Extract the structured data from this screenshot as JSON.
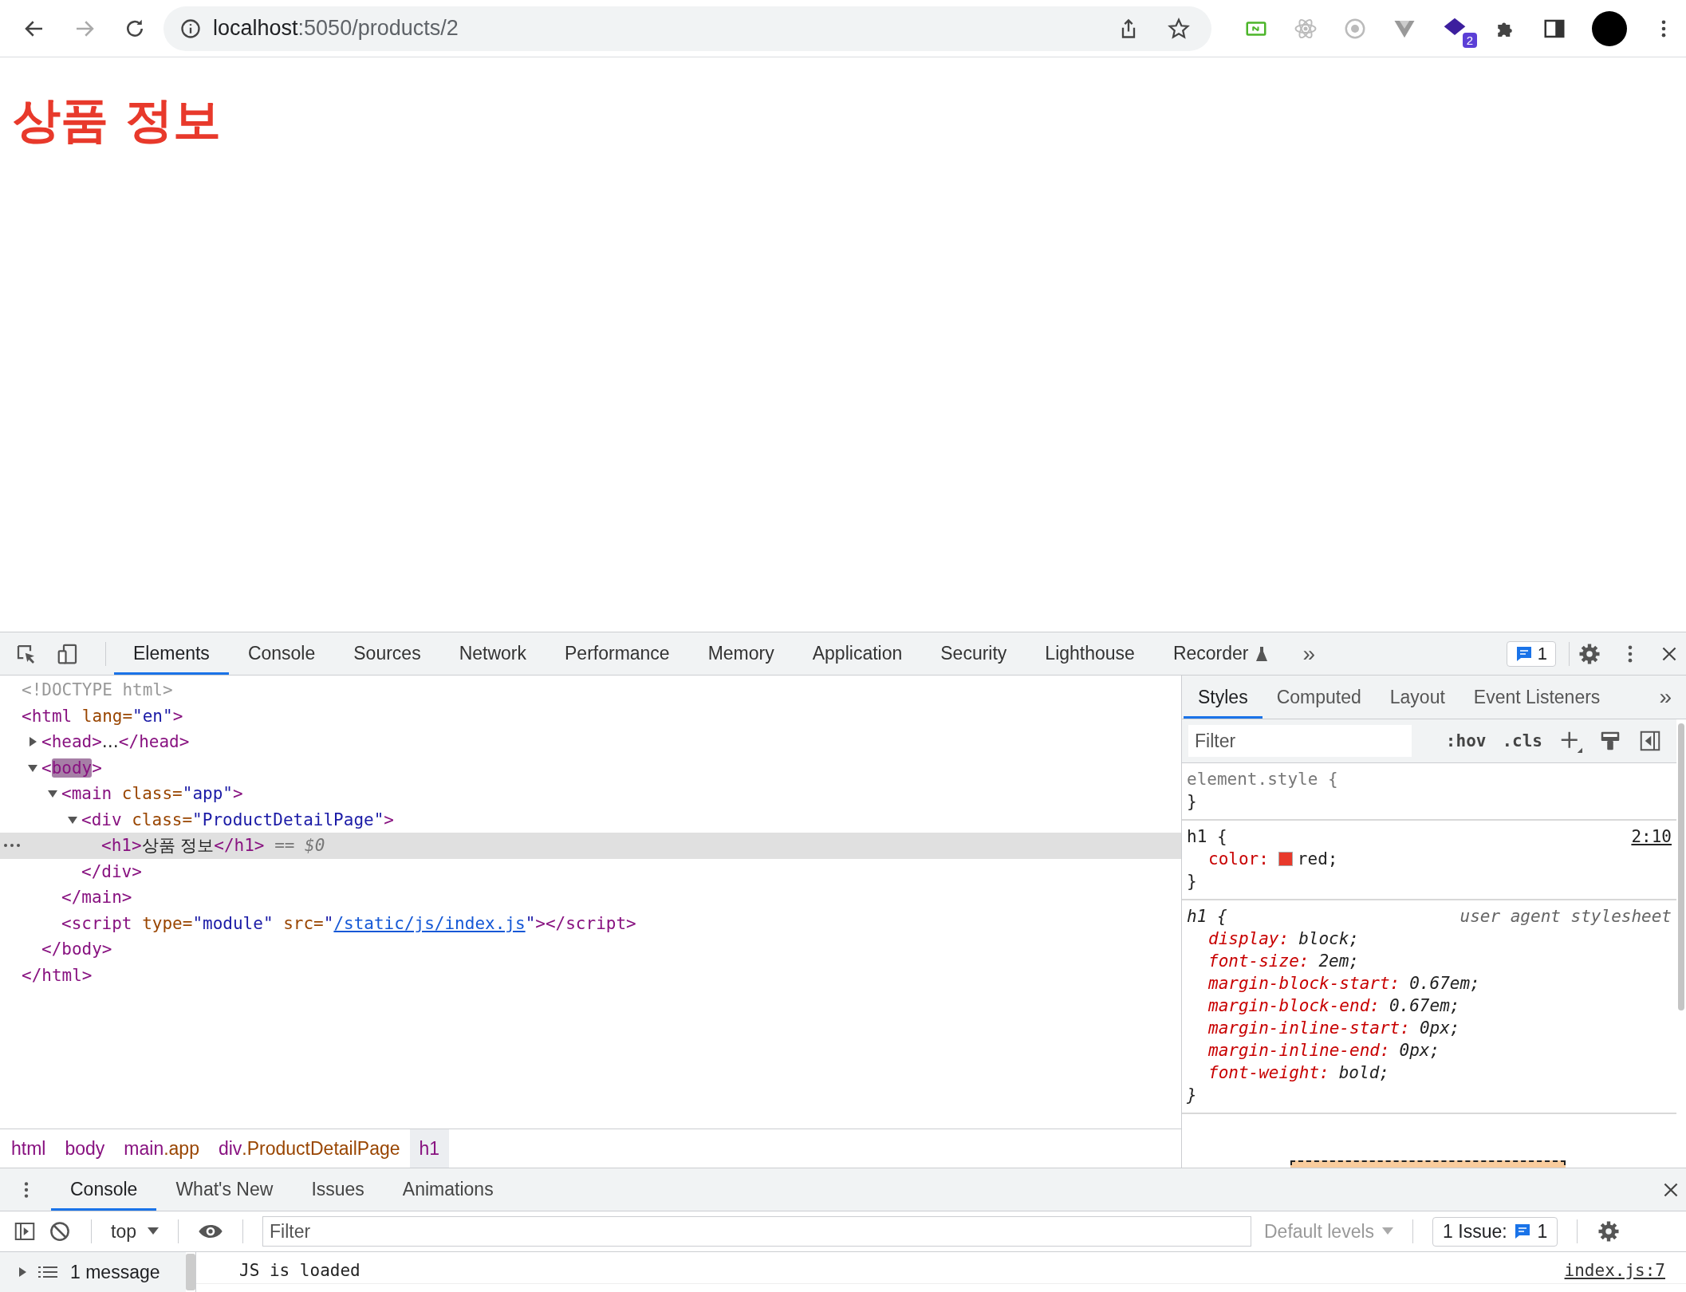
{
  "browser": {
    "url_host": "localhost",
    "url_path": ":5050/products/2",
    "extension_badge": "2"
  },
  "page": {
    "heading": "상품 정보"
  },
  "devtools": {
    "tabs": [
      {
        "label": "Elements",
        "selected": true,
        "flask": false
      },
      {
        "label": "Console",
        "selected": false,
        "flask": false
      },
      {
        "label": "Sources",
        "selected": false,
        "flask": false
      },
      {
        "label": "Network",
        "selected": false,
        "flask": false
      },
      {
        "label": "Performance",
        "selected": false,
        "flask": false
      },
      {
        "label": "Memory",
        "selected": false,
        "flask": false
      },
      {
        "label": "Application",
        "selected": false,
        "flask": false
      },
      {
        "label": "Security",
        "selected": false,
        "flask": false
      },
      {
        "label": "Lighthouse",
        "selected": false,
        "flask": false
      },
      {
        "label": "Recorder",
        "selected": false,
        "flask": true
      }
    ],
    "overflow": "»",
    "issues_count": "1",
    "elements": {
      "tree": [
        {
          "tokens": [
            {
              "kind": "comment",
              "text": "<!DOCTYPE html>"
            }
          ],
          "selected": false
        },
        {
          "tokens": [
            {
              "kind": "tag",
              "text": "<html"
            },
            {
              "kind": "attr",
              "text": " lang="
            },
            {
              "kind": "value",
              "text": "\"en\""
            },
            {
              "kind": "tag",
              "text": ">"
            }
          ],
          "selected": false,
          "closing": [
            {
              "kind": "tag",
              "text": "</html>"
            }
          ],
          "children": [
            {
              "tokens": [
                {
                  "kind": "tag",
                  "text": "<head>"
                },
                {
                  "kind": "text",
                  "text": "…"
                },
                {
                  "kind": "tag",
                  "text": "</head>"
                }
              ],
              "expanded": false,
              "selected": false
            },
            {
              "tokens": [
                {
                  "kind": "tag",
                  "text": "<"
                },
                {
                  "kind": "highlight",
                  "text": "body"
                },
                {
                  "kind": "tag",
                  "text": ">"
                }
              ],
              "expanded": true,
              "selected": false,
              "closing": [
                {
                  "kind": "tag",
                  "text": "</body>"
                }
              ],
              "children": [
                {
                  "tokens": [
                    {
                      "kind": "tag",
                      "text": "<main"
                    },
                    {
                      "kind": "attr",
                      "text": " class="
                    },
                    {
                      "kind": "value",
                      "text": "\"app\""
                    },
                    {
                      "kind": "tag",
                      "text": ">"
                    }
                  ],
                  "expanded": true,
                  "selected": false,
                  "closing": [
                    {
                      "kind": "tag",
                      "text": "</main>"
                    }
                  ],
                  "children": [
                    {
                      "tokens": [
                        {
                          "kind": "tag",
                          "text": "<div"
                        },
                        {
                          "kind": "attr",
                          "text": " class="
                        },
                        {
                          "kind": "value",
                          "text": "\"ProductDetailPage\""
                        },
                        {
                          "kind": "tag",
                          "text": ">"
                        }
                      ],
                      "expanded": true,
                      "selected": false,
                      "closing": [
                        {
                          "kind": "tag",
                          "text": "</div>"
                        }
                      ],
                      "children": [
                        {
                          "tokens": [
                            {
                              "kind": "tag",
                              "text": "<h1>"
                            },
                            {
                              "kind": "text",
                              "text": "상품 정보"
                            },
                            {
                              "kind": "tag",
                              "text": "</h1>"
                            },
                            {
                              "kind": "hint",
                              "text": " == $0"
                            }
                          ],
                          "selected": true
                        }
                      ]
                    }
                  ]
                },
                {
                  "tokens": [
                    {
                      "kind": "tag",
                      "text": "<script"
                    },
                    {
                      "kind": "attr",
                      "text": " type="
                    },
                    {
                      "kind": "value",
                      "text": "\"module\""
                    },
                    {
                      "kind": "attr",
                      "text": " src="
                    },
                    {
                      "kind": "value",
                      "text": "\""
                    },
                    {
                      "kind": "link",
                      "text": "/static/js/index.js"
                    },
                    {
                      "kind": "value",
                      "text": "\""
                    },
                    {
                      "kind": "tag",
                      "text": "></script>"
                    }
                  ],
                  "selected": false
                }
              ]
            }
          ]
        }
      ]
    },
    "breadcrumbs": [
      {
        "tag": "html",
        "selected": false
      },
      {
        "tag": "body",
        "selected": false
      },
      {
        "tag": "main",
        "class": ".app",
        "selected": false
      },
      {
        "tag": "div",
        "class": ".ProductDetailPage",
        "selected": false
      },
      {
        "tag": "h1",
        "selected": true
      }
    ],
    "styles": {
      "tabs": [
        {
          "label": "Styles",
          "selected": true
        },
        {
          "label": "Computed",
          "selected": false
        },
        {
          "label": "Layout",
          "selected": false
        },
        {
          "label": "Event Listeners",
          "selected": false
        }
      ],
      "overflow": "»",
      "filter_placeholder": "Filter",
      "hov": ":hov",
      "cls": ".cls",
      "rules": [
        {
          "kind": "inline",
          "selector": "element.style {",
          "close": "}"
        },
        {
          "kind": "author",
          "selector": "h1 {",
          "source": "2:10",
          "close": "}",
          "declarations": [
            {
              "property": "color:",
              "value": "red;",
              "color": "#e8392b"
            }
          ]
        },
        {
          "kind": "user_agent",
          "selector": "h1 {",
          "source": "user agent stylesheet",
          "close": "}",
          "declarations": [
            {
              "property": "display:",
              "value": "block;"
            },
            {
              "property": "font-size:",
              "value": "2em;"
            },
            {
              "property": "margin-block-start:",
              "value": "0.67em;"
            },
            {
              "property": "margin-block-end:",
              "value": "0.67em;"
            },
            {
              "property": "margin-inline-start:",
              "value": "0px;"
            },
            {
              "property": "margin-inline-end:",
              "value": "0px;"
            },
            {
              "property": "font-weight:",
              "value": "bold;"
            }
          ]
        }
      ]
    }
  },
  "drawer": {
    "tabs": [
      {
        "label": "Console",
        "selected": true
      },
      {
        "label": "What's New",
        "selected": false
      },
      {
        "label": "Issues",
        "selected": false
      },
      {
        "label": "Animations",
        "selected": false
      }
    ],
    "context": "top",
    "filter_placeholder": "Filter",
    "levels": "Default levels",
    "issues_label": "1 Issue:",
    "issues_count": "1",
    "sidebar_item": "1 message",
    "messages": [
      {
        "text": "JS is loaded",
        "source": "index.js:7"
      }
    ]
  }
}
